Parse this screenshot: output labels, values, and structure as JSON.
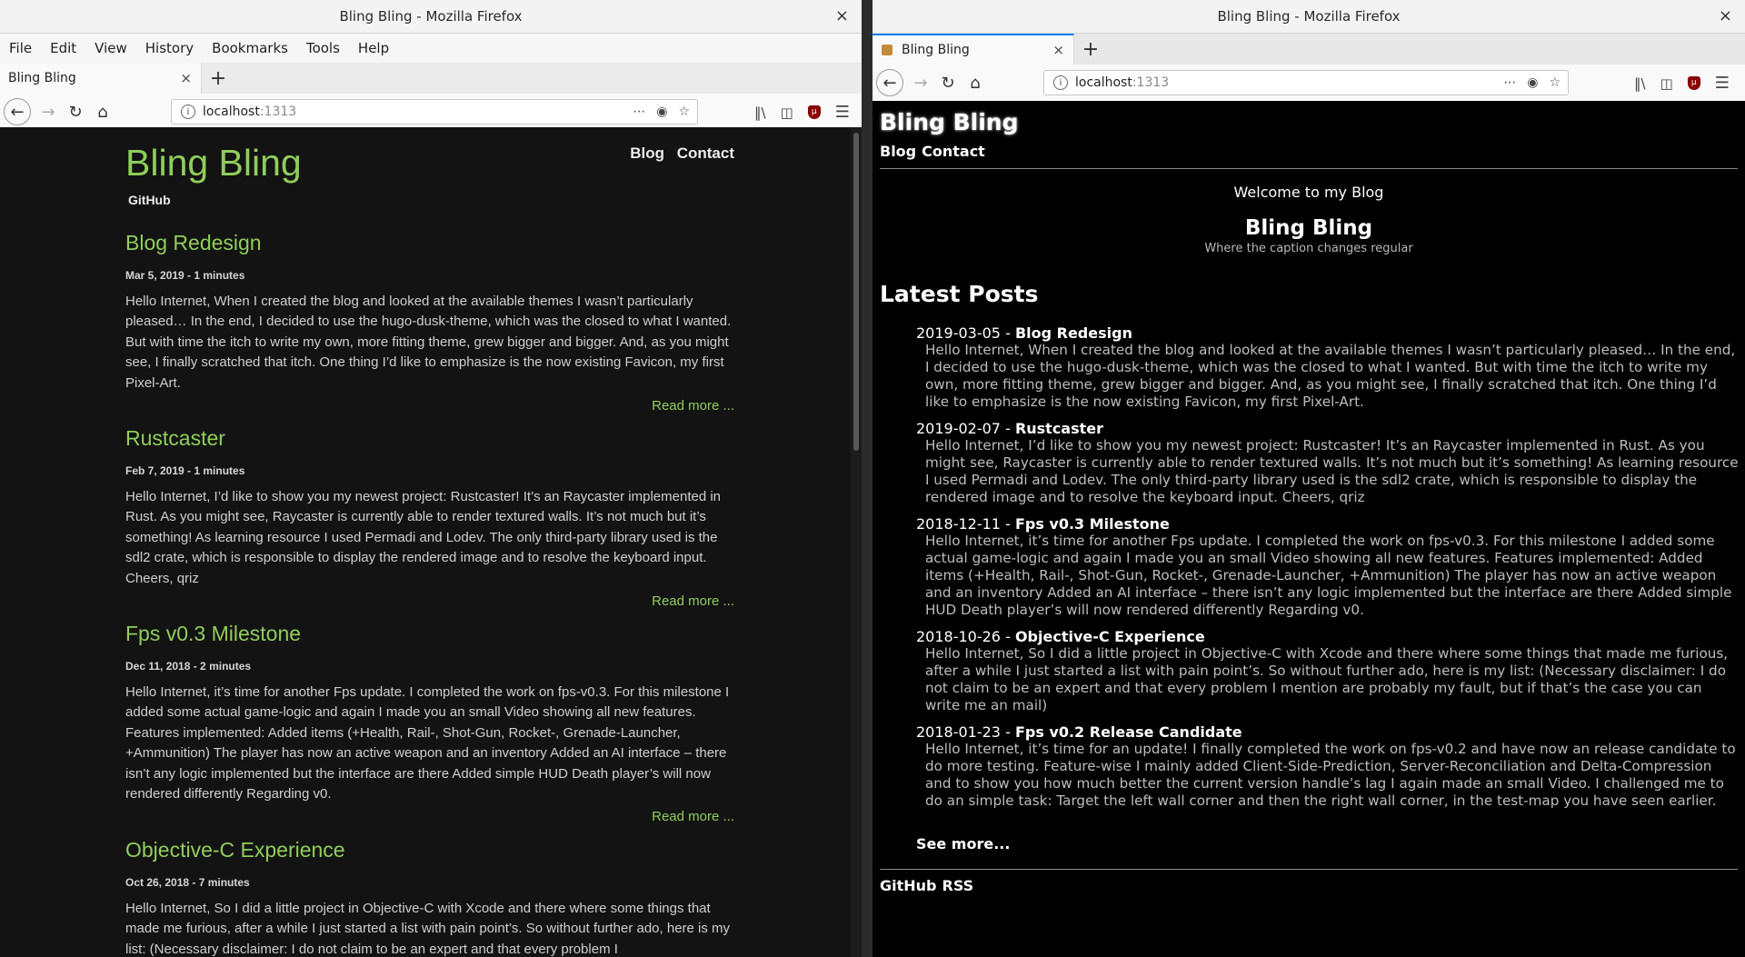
{
  "left_window": {
    "title": "Bling Bling - Mozilla Firefox",
    "close": "×",
    "menu": [
      "File",
      "Edit",
      "View",
      "History",
      "Bookmarks",
      "Tools",
      "Help"
    ],
    "tab_label": "Bling Bling",
    "tab_close": "×",
    "new_tab": "+",
    "url_host": "localhost",
    "url_port": ":1313",
    "page": {
      "site_title": "Bling Bling",
      "nav": [
        "Blog",
        "Contact"
      ],
      "github": "GitHub",
      "read_more": "Read more ...",
      "posts": [
        {
          "title": "Blog Redesign",
          "meta": "Mar 5, 2019 - 1 minutes",
          "excerpt": "Hello Internet, When I created the blog and looked at the available themes I wasn’t particularly pleased… In the end, I decided to use the hugo-dusk-theme, which was the closed to what I wanted. But with time the itch to write my own, more fitting theme, grew bigger and bigger. And, as you might see, I finally scratched that itch. One thing I’d like to emphasize is the now existing Favicon, my first Pixel-Art."
        },
        {
          "title": "Rustcaster",
          "meta": "Feb 7, 2019 - 1 minutes",
          "excerpt": "Hello Internet, I’d like to show you my newest project: Rustcaster! It’s an Raycaster implemented in Rust. As you might see, Raycaster is currently able to render textured walls. It’s not much but it’s something! As learning resource I used Permadi and Lodev. The only third-party library used is the sdl2 crate, which is responsible to display the rendered image and to resolve the keyboard input. Cheers, qriz"
        },
        {
          "title": "Fps v0.3 Milestone",
          "meta": "Dec 11, 2018 - 2 minutes",
          "excerpt": "Hello Internet, it’s time for another Fps update. I completed the work on fps-v0.3. For this milestone I added some actual game-logic and again I made you an small Video showing all new features. Features implemented: Added items (+Health, Rail-, Shot-Gun, Rocket-, Grenade-Launcher, +Ammunition) The player has now an active weapon and an inventory Added an AI interface – there isn’t any logic implemented but the interface are there Added simple HUD Death player’s will now rendered differently Regarding v0."
        },
        {
          "title": "Objective-C Experience",
          "meta": "Oct 26, 2018 - 7 minutes",
          "excerpt": "Hello Internet, So I did a little project in Objective-C with Xcode and there where some things that made me furious, after a while I just started a list with pain point’s. So without further ado, here is my list: (Necessary disclaimer: I do not claim to be an expert and that every problem I"
        }
      ]
    }
  },
  "right_window": {
    "title": "Bling Bling - Mozilla Firefox",
    "close": "×",
    "tab_label": "Bling Bling",
    "tab_close": "×",
    "new_tab": "+",
    "url_host": "localhost",
    "url_port": ":1313",
    "page": {
      "site_title": "Bling Bling",
      "nav": [
        "Blog",
        "Contact"
      ],
      "welcome": "Welcome to my Blog",
      "name": "Bling Bling",
      "caption": "Where the caption changes regular",
      "latest_heading": "Latest Posts",
      "posts": [
        {
          "date": "2019-03-05 - ",
          "title": "Blog Redesign",
          "summary": "Hello Internet, When I created the blog and looked at the available themes I wasn’t particularly pleased… In the end, I decided to use the hugo-dusk-theme, which was the closed to what I wanted. But with time the itch to write my own, more fitting theme, grew bigger and bigger. And, as you might see, I finally scratched that itch. One thing I’d like to emphasize is the now existing Favicon, my first Pixel-Art."
        },
        {
          "date": "2019-02-07 - ",
          "title": "Rustcaster",
          "summary": "Hello Internet, I’d like to show you my newest project: Rustcaster! It’s an Raycaster implemented in Rust. As you might see, Raycaster is currently able to render textured walls. It’s not much but it’s something! As learning resource I used Permadi and Lodev. The only third-party library used is the sdl2 crate, which is responsible to display the rendered image and to resolve the keyboard input. Cheers, qriz"
        },
        {
          "date": "2018-12-11 - ",
          "title": "Fps v0.3 Milestone",
          "summary": "Hello Internet, it’s time for another Fps update. I completed the work on fps-v0.3. For this milestone I added some actual game-logic and again I made you an small Video showing all new features. Features implemented: Added items (+Health, Rail-, Shot-Gun, Rocket-, Grenade-Launcher, +Ammunition) The player has now an active weapon and an inventory Added an AI interface – there isn’t any logic implemented but the interface are there Added simple HUD Death player’s will now rendered differently Regarding v0."
        },
        {
          "date": "2018-10-26 - ",
          "title": "Objective-C Experience",
          "summary": "Hello Internet, So I did a little project in Objective-C with Xcode and there where some things that made me furious, after a while I just started a list with pain point’s. So without further ado, here is my list: (Necessary disclaimer: I do not claim to be an expert and that every problem I mention are probably my fault, but if that’s the case you can write me an mail)"
        },
        {
          "date": "2018-01-23 - ",
          "title": "Fps v0.2 Release Candidate",
          "summary": "Hello Internet, it’s time for an update! I finally completed the work on fps-v0.2 and have now an release candidate to do more testing. Feature-wise I mainly added Client-Side-Prediction, Server-Reconciliation and Delta-Compression and to show you how much better the current version handle’s lag I again made an small Video. I challenged me to do an simple task: Target the left wall corner and then the right wall corner, in the test-map you have seen earlier."
        }
      ],
      "see_more": "See more...",
      "footer": [
        "GitHub",
        "RSS"
      ]
    }
  },
  "colors": {
    "dusk_accent": "#8fce5a",
    "dusk_bg": "#131313",
    "right_bg": "#000000"
  }
}
